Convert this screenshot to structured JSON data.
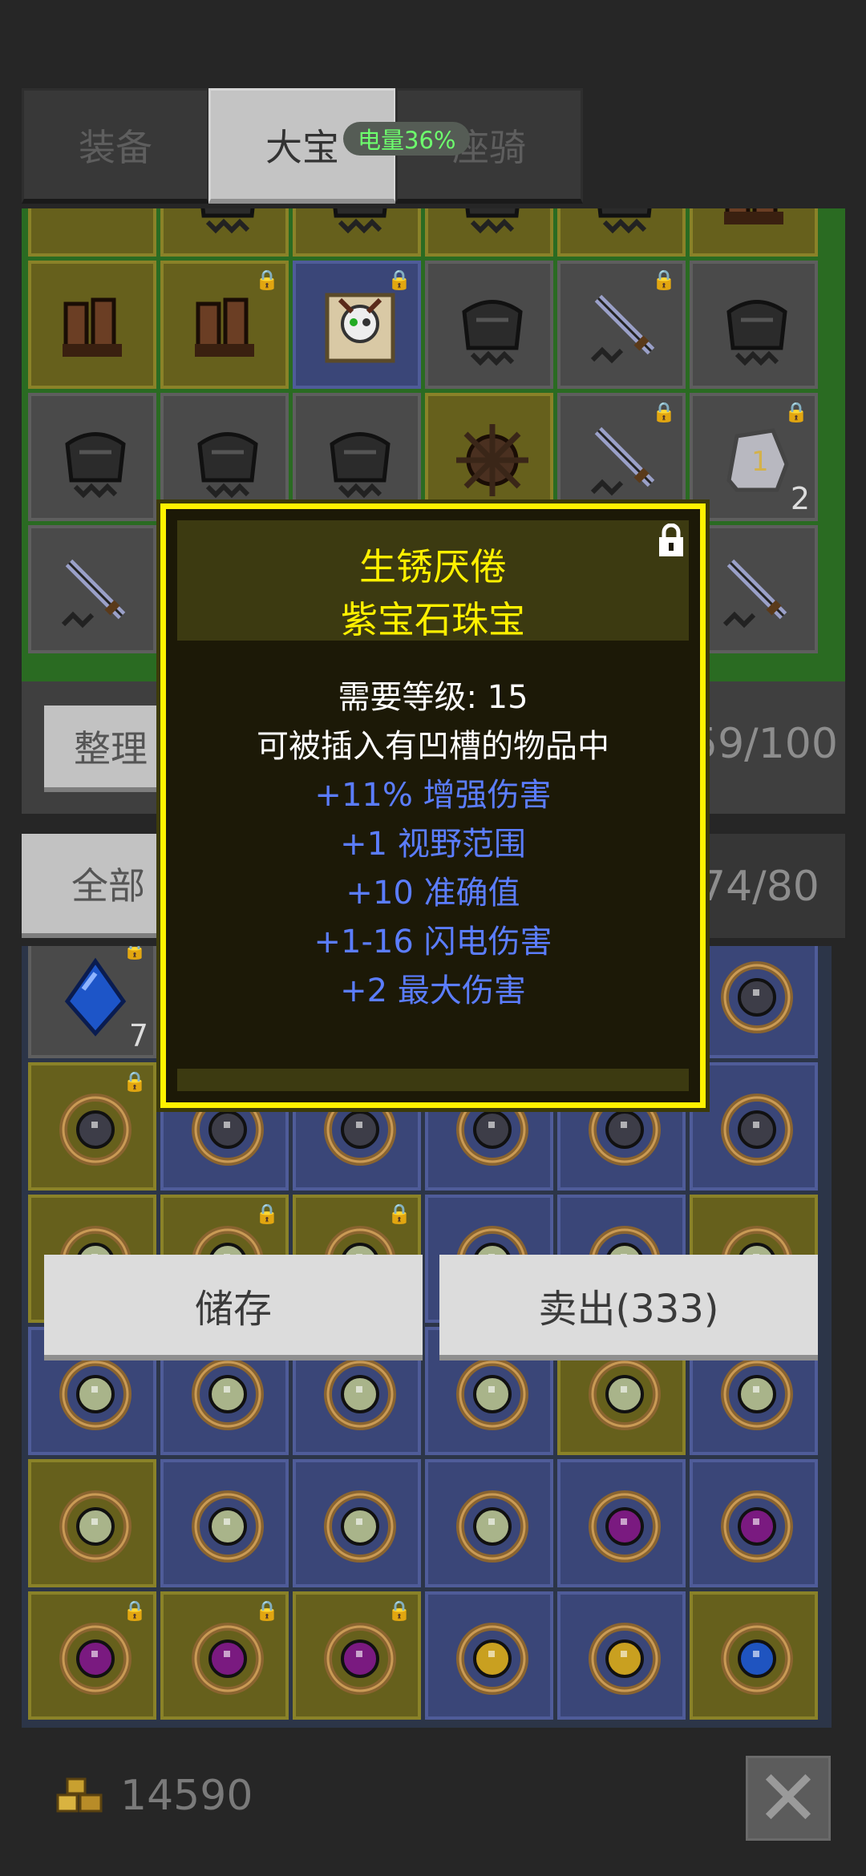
{
  "tabs": [
    {
      "label": "装备",
      "active": false
    },
    {
      "label": "大宝",
      "active": true
    },
    {
      "label": "座骑",
      "active": false
    }
  ],
  "battery": {
    "label": "电量36%"
  },
  "upper_panel": {
    "sort_label": "整理",
    "count": "59/100",
    "rows": [
      [
        {
          "c": "yellow",
          "i": "partial-item-icon"
        },
        {
          "c": "yellow",
          "i": "armor-icon"
        },
        {
          "c": "yellow",
          "i": "armor-icon"
        },
        {
          "c": "yellow",
          "i": "armor-icon"
        },
        {
          "c": "yellow",
          "i": "armor-icon"
        },
        {
          "c": "yellow",
          "i": "boots-icon"
        }
      ],
      [
        {
          "c": "yellow",
          "i": "boots-icon"
        },
        {
          "c": "yellow",
          "i": "boots-icon",
          "lock": true
        },
        {
          "c": "blue",
          "i": "skull-map-icon",
          "lock": true
        },
        {
          "c": "gray",
          "i": "helmet-icon"
        },
        {
          "c": "gray",
          "i": "sword-icon",
          "lock": true
        },
        {
          "c": "gray",
          "i": "helmet-icon"
        }
      ],
      [
        {
          "c": "gray",
          "i": "helmet-icon"
        },
        {
          "c": "gray",
          "i": "helmet-icon"
        },
        {
          "c": "gray",
          "i": "helmet-icon"
        },
        {
          "c": "yellow",
          "i": "spiked-shield-icon"
        },
        {
          "c": "gray",
          "i": "sword-icon",
          "lock": true
        },
        {
          "c": "gray",
          "i": "rune-stone-icon",
          "lock": true,
          "qty": "2"
        }
      ],
      [
        {
          "c": "gray",
          "i": "spear-icon"
        },
        {
          "c": "gray",
          "i": "spear-icon"
        },
        {
          "c": "gray",
          "i": "spear-icon"
        },
        {
          "c": "gray",
          "i": "spear-icon"
        },
        {
          "c": "gray",
          "i": "spear-icon"
        },
        {
          "c": "gray",
          "i": "spear-icon"
        }
      ]
    ]
  },
  "lower_panel": {
    "filter_label": "全部",
    "count": "74/80",
    "rows": [
      [
        {
          "c": "gray",
          "i": "sapphire-gem-icon",
          "lock": true,
          "qty": "7"
        },
        {
          "c": "gray",
          "i": "jewel-gray-icon"
        },
        {
          "c": "gray",
          "i": "jewel-gray-icon"
        },
        {
          "c": "gray",
          "i": "jewel-gray-icon"
        },
        {
          "c": "gray",
          "i": "jewel-gray-icon"
        },
        {
          "c": "blue",
          "i": "jewel-gray-icon"
        }
      ],
      [
        {
          "c": "yellow",
          "i": "jewel-gray-icon",
          "lock": true
        },
        {
          "c": "blue",
          "i": "jewel-gray-icon"
        },
        {
          "c": "blue",
          "i": "jewel-gray-icon"
        },
        {
          "c": "blue",
          "i": "jewel-gray-icon"
        },
        {
          "c": "blue",
          "i": "jewel-gray-icon"
        },
        {
          "c": "blue",
          "i": "jewel-gray-icon"
        }
      ],
      [
        {
          "c": "yellow",
          "i": "jewel-white-icon"
        },
        {
          "c": "yellow",
          "i": "jewel-white-icon",
          "lock": true
        },
        {
          "c": "yellow",
          "i": "jewel-white-icon",
          "lock": true
        },
        {
          "c": "blue",
          "i": "jewel-white-icon"
        },
        {
          "c": "blue",
          "i": "jewel-white-icon"
        },
        {
          "c": "yellow",
          "i": "jewel-white-icon"
        }
      ],
      [
        {
          "c": "blue",
          "i": "jewel-white-icon"
        },
        {
          "c": "blue",
          "i": "jewel-white-icon"
        },
        {
          "c": "blue",
          "i": "jewel-white-icon"
        },
        {
          "c": "blue",
          "i": "jewel-white-icon"
        },
        {
          "c": "yellow",
          "i": "jewel-white-icon"
        },
        {
          "c": "blue",
          "i": "jewel-white-icon"
        }
      ],
      [
        {
          "c": "yellow",
          "i": "jewel-white-icon"
        },
        {
          "c": "blue",
          "i": "jewel-white-icon"
        },
        {
          "c": "blue",
          "i": "jewel-white-icon"
        },
        {
          "c": "blue",
          "i": "jewel-white-icon"
        },
        {
          "c": "blue",
          "i": "jewel-purple-icon"
        },
        {
          "c": "blue",
          "i": "jewel-purple-icon"
        }
      ],
      [
        {
          "c": "yellow",
          "i": "jewel-purple-icon",
          "lock": true
        },
        {
          "c": "yellow",
          "i": "jewel-purple-icon",
          "lock": true
        },
        {
          "c": "yellow",
          "i": "jewel-purple-icon",
          "lock": true
        },
        {
          "c": "blue",
          "i": "jewel-amber-icon"
        },
        {
          "c": "blue",
          "i": "jewel-amber-icon"
        },
        {
          "c": "yellow",
          "i": "jewel-blue-icon"
        }
      ]
    ]
  },
  "tooltip": {
    "name": "生锈厌倦",
    "type": "紫宝石珠宝",
    "requirement": "需要等级: 15",
    "note": "可被插入有凹槽的物品中",
    "mods": [
      "+11% 增强伤害",
      "+1 视野范围",
      "+10 准确值",
      "+1-16 闪电伤害",
      "+2 最大伤害"
    ],
    "mod_color": "#5b7dff"
  },
  "actions": {
    "store_label": "储存",
    "sell_label": "卖出(333)"
  },
  "gold": {
    "amount": "14590"
  },
  "colors": {
    "tooltip_border": "#fff200",
    "title": "#fff000",
    "battery_text": "#6dff6d"
  }
}
